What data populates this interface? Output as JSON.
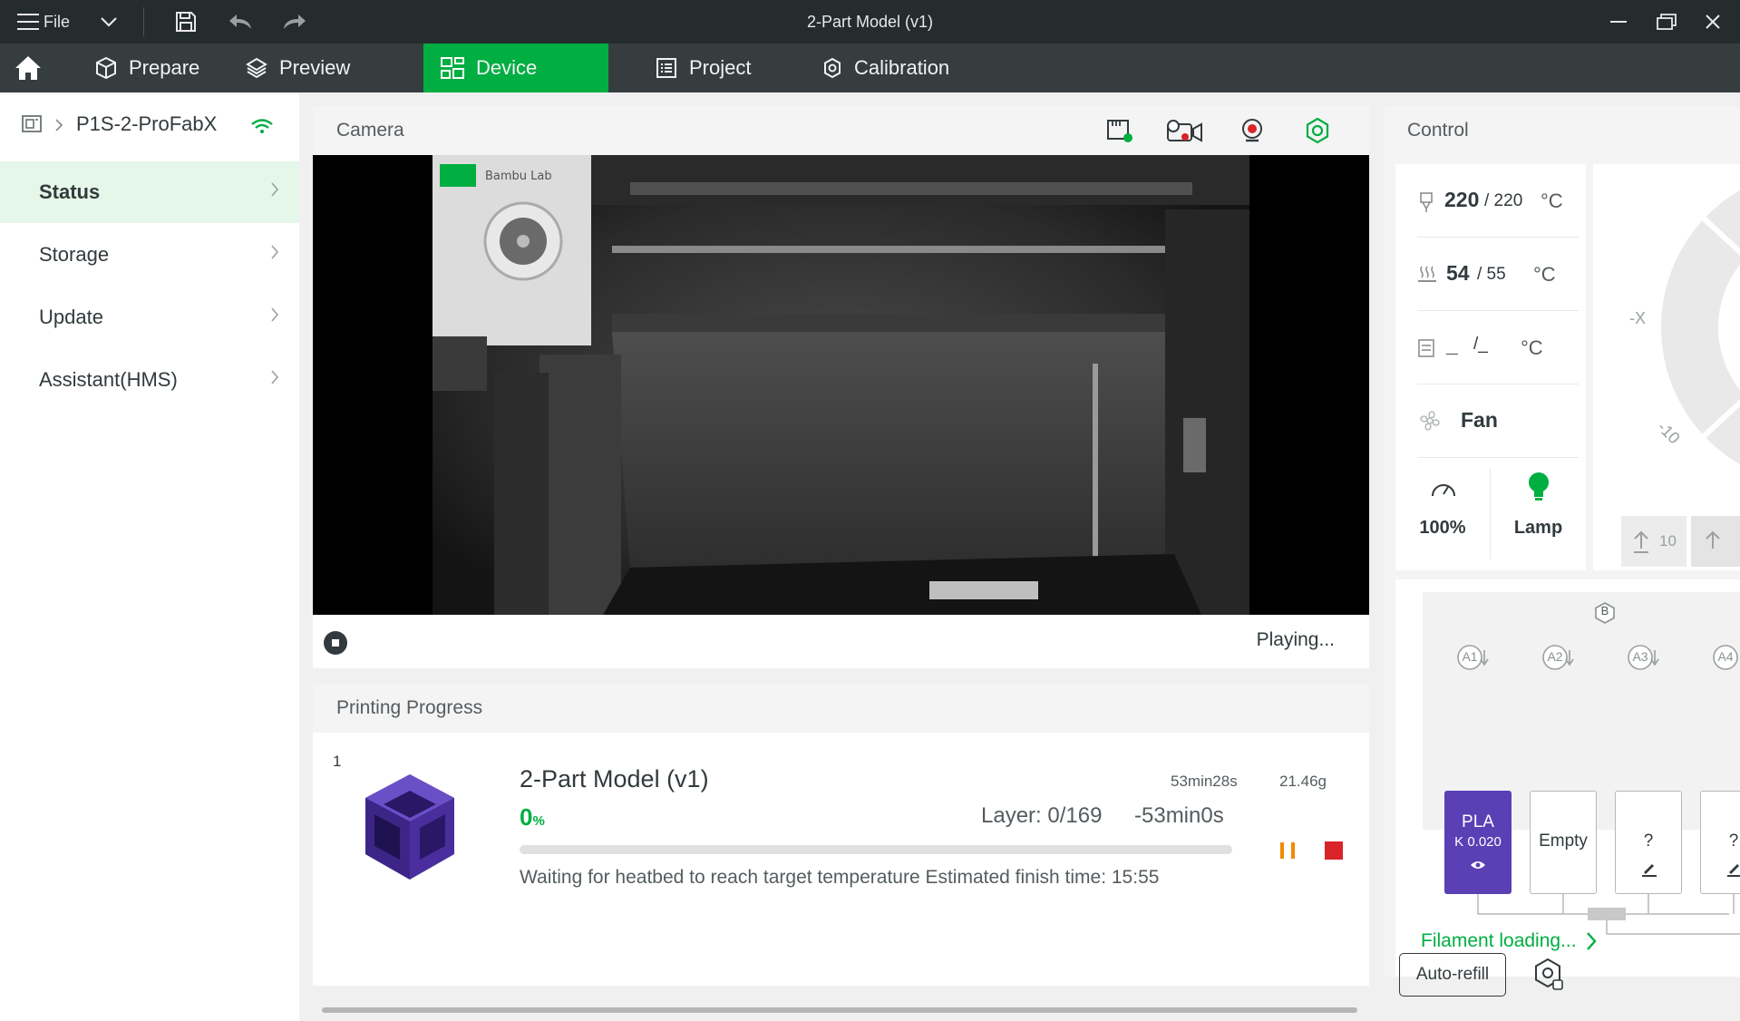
{
  "window": {
    "title": "2-Part Model (v1)",
    "file_menu_label": "File"
  },
  "tabs": [
    {
      "label": "Prepare"
    },
    {
      "label": "Preview"
    },
    {
      "label": "Device"
    },
    {
      "label": "Project"
    },
    {
      "label": "Calibration"
    }
  ],
  "colors": {
    "accent": "#00ae42",
    "titlebar": "#242c2e",
    "tabbar": "#353d3f",
    "filament_purple": "#5b3fb5",
    "stop_red": "#d8242a",
    "pause_orange": "#f08a00"
  },
  "sidebar": {
    "device_name": "P1S-2-ProFabX",
    "items": [
      {
        "label": "Status"
      },
      {
        "label": "Storage"
      },
      {
        "label": "Update"
      },
      {
        "label": "Assistant(HMS)"
      }
    ]
  },
  "camera": {
    "title": "Camera",
    "status": "Playing...",
    "overlay_logo": "Bambu Lab"
  },
  "progress": {
    "title": "Printing Progress",
    "plate_number": "1",
    "model_name": "2-Part Model (v1)",
    "total_time": "53min28s",
    "weight": "21.46g",
    "percent_value": "0",
    "percent_unit": "%",
    "fraction": 0,
    "layer": "Layer: 0/169",
    "remaining": "-53min0s",
    "message": "Waiting for heatbed to reach target temperature Estimated finish time: 15:55"
  },
  "control": {
    "title": "Control",
    "nozzle_current": "220",
    "nozzle_target": "/ 220",
    "bed_current": "54",
    "bed_target": "/ 55",
    "chamber_current": "_",
    "chamber_target": "/_",
    "temp_unit": "°C",
    "fan_label": "Fan",
    "speed_label": "100%",
    "lamp_label": "Lamp",
    "axis_minus_x": "-X",
    "axis_minus_10": "-10",
    "z_step": "10"
  },
  "ams": {
    "badge": "B",
    "slots": [
      {
        "tag": "A1",
        "line1": "PLA",
        "line2": "K 0.020"
      },
      {
        "tag": "A2",
        "line1": "Empty"
      },
      {
        "tag": "A3",
        "line1": "?"
      },
      {
        "tag": "A4",
        "line1": "?"
      }
    ],
    "auto_refill_label": "Auto-refill",
    "filament_loading_label": "Filament loading..."
  }
}
